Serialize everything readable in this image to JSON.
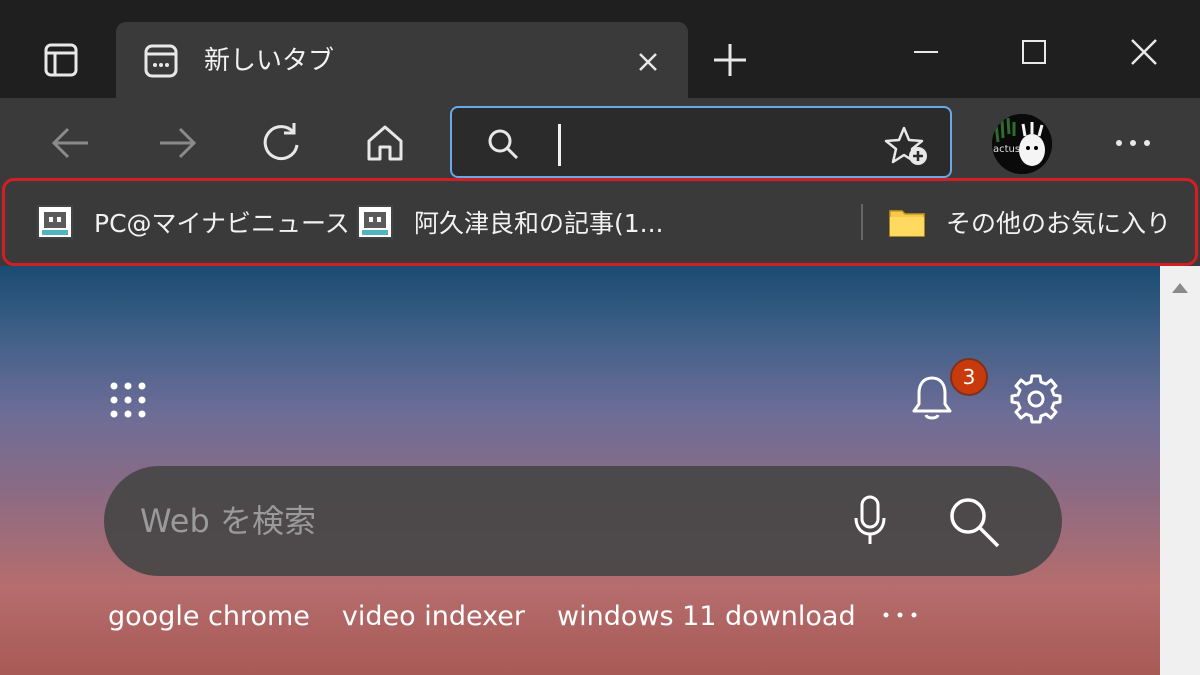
{
  "tab": {
    "title": "新しいタブ"
  },
  "address_bar": {
    "value": ""
  },
  "profile": {
    "text": "actus"
  },
  "favorites": {
    "items": [
      {
        "label": "PC@マイナビニュース",
        "icon": "site-favicon"
      },
      {
        "label": "阿久津良和の記事(1...",
        "icon": "site-favicon"
      }
    ],
    "other_label": "その他のお気に入り",
    "highlight_color": "#d21f26"
  },
  "content": {
    "notification_count": "3",
    "search_placeholder": "Web を検索",
    "suggestions": [
      "google chrome",
      "video indexer",
      "windows 11 download"
    ]
  },
  "colors": {
    "accent": "#6aa8e6",
    "badge": "#c83a0c"
  }
}
